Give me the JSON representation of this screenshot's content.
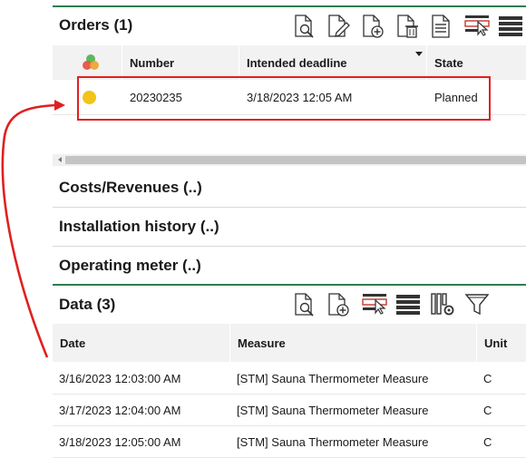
{
  "orders": {
    "title": "Orders (1)",
    "columns": {
      "number": "Number",
      "deadline": "Intended deadline",
      "state": "State"
    },
    "rows": [
      {
        "number": "20230235",
        "deadline": "3/18/2023 12:05 AM",
        "state": "Planned",
        "status_color": "#f0c419"
      }
    ],
    "toolbar_icons": [
      "view-document-icon",
      "edit-document-icon",
      "add-document-icon",
      "delete-document-icon",
      "report-icon",
      "select-row-icon",
      "columns-icon"
    ]
  },
  "sections": {
    "costs": "Costs/Revenues (..)",
    "installation": "Installation history (..)",
    "meter": "Operating meter (..)"
  },
  "data_panel": {
    "title": "Data (3)",
    "columns": {
      "date": "Date",
      "measure": "Measure",
      "unit": "Unit"
    },
    "rows": [
      {
        "date": "3/16/2023 12:03:00 AM",
        "measure": "[STM] Sauna Thermometer Measure",
        "unit": "C"
      },
      {
        "date": "3/17/2023 12:04:00 AM",
        "measure": "[STM] Sauna Thermometer Measure",
        "unit": "C"
      },
      {
        "date": "3/18/2023 12:05:00 AM",
        "measure": "[STM] Sauna Thermometer Measure",
        "unit": "C"
      }
    ],
    "toolbar_icons": [
      "view-document-icon",
      "add-document-icon",
      "select-row-icon",
      "columns-icon",
      "column-settings-icon",
      "filter-icon"
    ]
  },
  "colors": {
    "accent_green": "#2e7d4f",
    "highlight_red": "#e02020",
    "status_yellow": "#f0c419"
  }
}
